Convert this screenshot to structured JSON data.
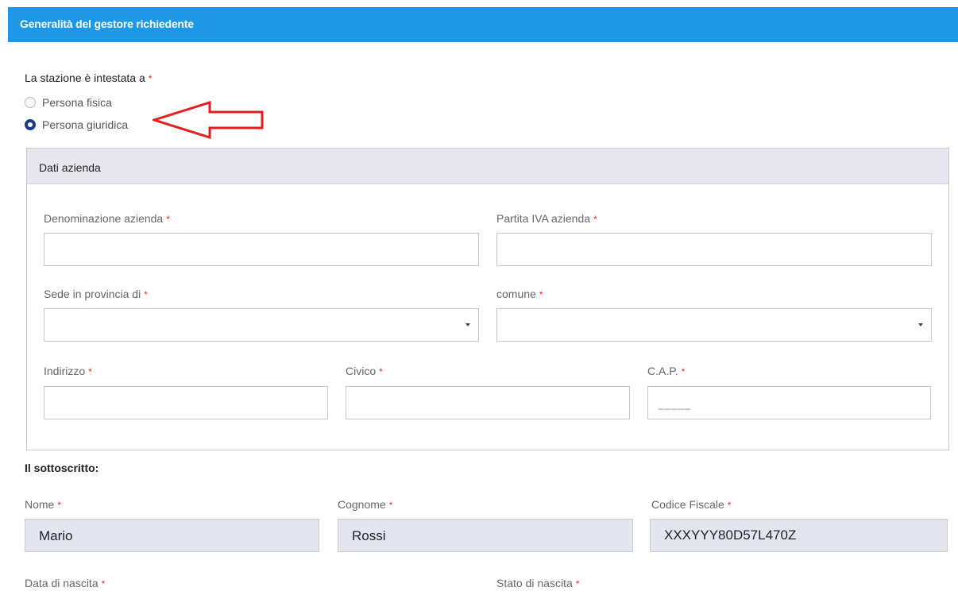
{
  "header": {
    "title": "Generalità del gestore richiedente"
  },
  "question": {
    "label": "La stazione è intestata a",
    "required": "*"
  },
  "radios": [
    {
      "label": "Persona fisica",
      "selected": false
    },
    {
      "label": "Persona giuridica",
      "selected": true
    }
  ],
  "company": {
    "title": "Dati azienda",
    "fields": {
      "denominazione": {
        "label": "Denominazione azienda",
        "required": "*",
        "value": ""
      },
      "piva": {
        "label": "Partita IVA azienda",
        "required": "*",
        "value": ""
      },
      "provincia": {
        "label": "Sede in provincia di",
        "required": "*",
        "value": ""
      },
      "comune": {
        "label": "comune",
        "required": "*",
        "value": ""
      },
      "indirizzo": {
        "label": "Indirizzo",
        "required": "*",
        "value": ""
      },
      "civico": {
        "label": "Civico",
        "required": "*",
        "value": ""
      },
      "cap": {
        "label": "C.A.P.",
        "required": "*",
        "value": "",
        "mask": "_____"
      }
    }
  },
  "signer": {
    "title": "Il sottoscritto:",
    "fields": {
      "nome": {
        "label": "Nome",
        "required": "*",
        "value": "Mario"
      },
      "cognome": {
        "label": "Cognome",
        "required": "*",
        "value": "Rossi"
      },
      "cf": {
        "label": "Codice Fiscale",
        "required": "*",
        "value": "XXXYYY80D57L470Z"
      },
      "data": {
        "label": "Data di nascita",
        "required": "*"
      },
      "stato": {
        "label": "Stato di nascita",
        "required": "*"
      }
    }
  },
  "colors": {
    "header": "#1c98e6",
    "required": "#d9302b",
    "radio_selected": "#1b3a8c",
    "arrow": "#e02020"
  }
}
